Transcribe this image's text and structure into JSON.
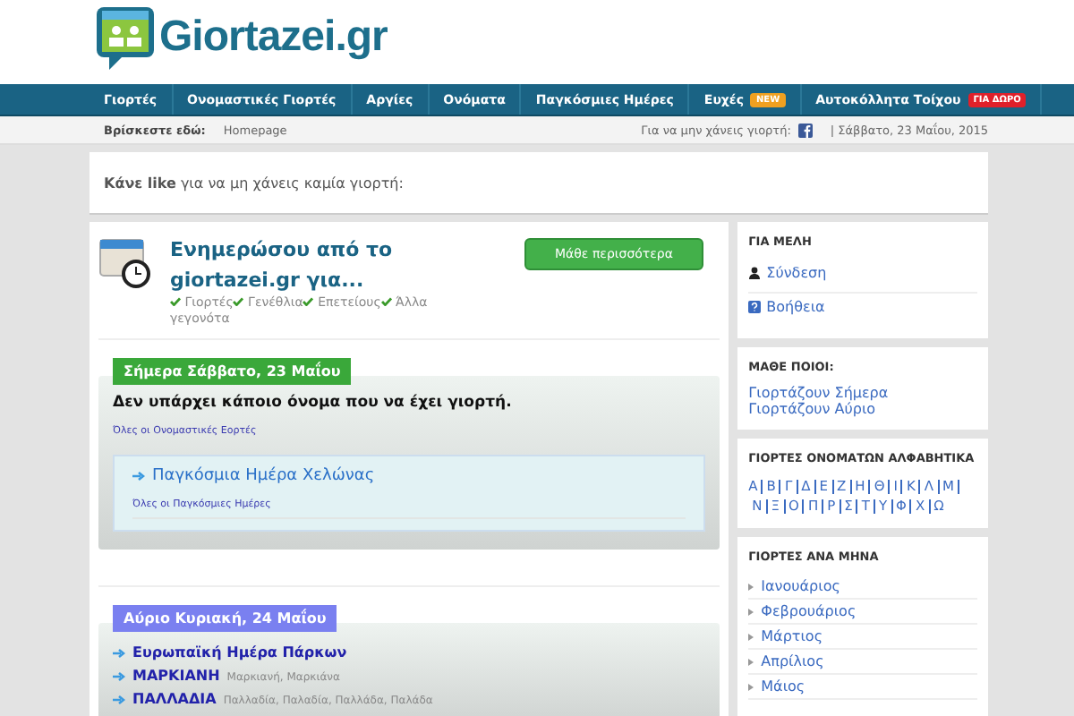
{
  "logo": {
    "text": "Giortazei",
    "suffix": ".gr"
  },
  "nav": [
    {
      "label": "Γιορτές"
    },
    {
      "label": "Ονομαστικές Γιορτές"
    },
    {
      "label": "Αργίες"
    },
    {
      "label": "Ονόματα"
    },
    {
      "label": "Παγκόσμιες Ημέρες"
    },
    {
      "label": "Ευχές",
      "badge": "NEW",
      "color": "#f0a020"
    },
    {
      "label": "Αυτοκόλλητα Τοίχου",
      "badge": "ΓΙΑ ΔΩΡΟ",
      "color": "#e0202a"
    }
  ],
  "breadcrumb": {
    "label": "Βρίσκεστε εδώ:",
    "path": "Homepage",
    "follow": "Για να μην χάνεις γιορτή:",
    "date": "| Σάββατο, 23 Μαΐου, 2015"
  },
  "like_bar": "**Κάνε like** για να μη χάνεις καμία γιορτή:",
  "promo": {
    "title": "Ενημερώσου από το giortazei.gr για...",
    "button": "Μάθε περισσότερα",
    "features": [
      "Γιορτές",
      "Γενέθλια",
      "Επετείους",
      "Άλλα γεγονότα"
    ]
  },
  "today": {
    "heading": "Σήμερα Σάββατο, 23 Μαΐου",
    "message": "Δεν υπάρχει κάποιο όνομα που να έχει γιορτή.",
    "all_link": "Όλες οι Ονομαστικές Εορτές",
    "world_day": "Παγκόσμια Ημέρα Χελώνας",
    "world_link": "Όλες οι Παγκόσμιες Ημέρες"
  },
  "tomorrow": {
    "heading": "Αύριο Κυριακή, 24 Μαΐου",
    "items": [
      {
        "name": "Ευρωπαϊκή Ημέρα Πάρκων"
      },
      {
        "name": "ΜΑΡΚΙΑΝΗ",
        "variants": "Μαρκιανή, Μαρκιάνα"
      },
      {
        "name": "ΠΑΛΛΑΔΙΑ",
        "variants": "Παλλαδία, Παλαδία, Παλλάδα, Παλάδα"
      }
    ]
  },
  "sidebar": {
    "members": {
      "title": "ΓΙΑ ΜΕΛΗ",
      "login": "Σύνδεση",
      "help": "Βοήθεια"
    },
    "learn": {
      "title": "ΜΑΘΕ ΠΟΙΟΙ:",
      "links": [
        "Γιορτάζουν Σήμερα",
        "Γιορτάζουν Αύριο"
      ]
    },
    "alphabet": {
      "title": "ΓΙΟΡΤΕΣ ΟΝΟΜΑΤΩΝ ΑΛΦΑΒΗΤΙΚΑ",
      "letters": [
        "Α",
        "Β",
        "Γ",
        "Δ",
        "Ε",
        "Ζ",
        "Η",
        "Θ",
        "Ι",
        "Κ",
        "Λ",
        "Μ",
        "Ν",
        "Ξ",
        "Ο",
        "Π",
        "Ρ",
        "Σ",
        "Τ",
        "Υ",
        "Φ",
        "Χ",
        "Ω"
      ]
    },
    "months": {
      "title": "ΓΙΟΡΤΕΣ ΑΝΑ ΜΗΝΑ",
      "items": [
        "Ιανουάριος",
        "Φεβρουάριος",
        "Μάρτιος",
        "Απρίλιος",
        "Μάιος"
      ]
    }
  }
}
